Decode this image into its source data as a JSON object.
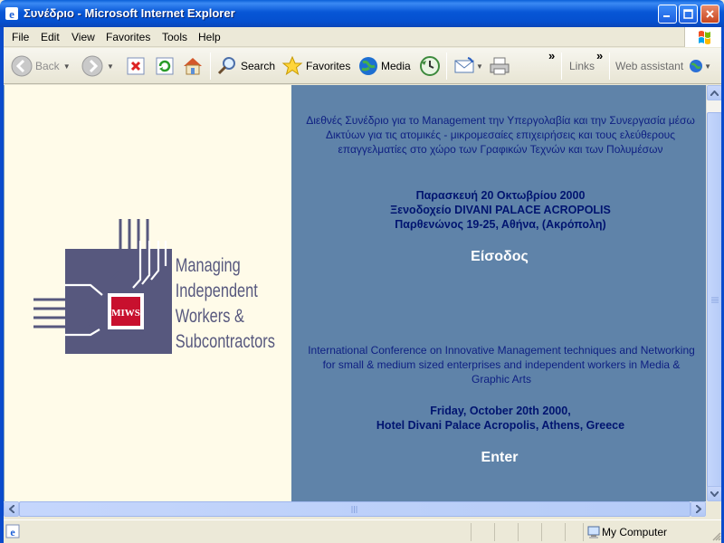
{
  "window": {
    "title": "Συνέδριο - Microsoft Internet Explorer"
  },
  "menu": {
    "items": [
      "File",
      "Edit",
      "View",
      "Favorites",
      "Tools",
      "Help"
    ]
  },
  "toolbar": {
    "back_label": "Back",
    "search_label": "Search",
    "favorites_label": "Favorites",
    "media_label": "Media",
    "links_label": "Links",
    "web_assistant_label": "Web assistant",
    "chevron": "»"
  },
  "logo": {
    "badge": "MIWS",
    "line1": "Managing",
    "line2": "Independent",
    "line3": "Workers &",
    "line4": "Subcontractors"
  },
  "greek": {
    "description": "Διεθνές Συνέδριο για το Management την Υπεργολαβία και την Συνεργασία μέσω Δικτύων για τις ατομικές - μικρομεσαίες επιχειρήσεις και τους ελεύθερους επαγγελματίες στο χώρο των Γραφικών Τεχνών και των Πολυμέσων",
    "date": "Παρασκευή 20 Οκτωβρίου 2000",
    "venue": "Ξενοδοχείο DIVANI PALACE ACROPOLIS",
    "address": "Παρθενώνος 19-25, Αθήνα, (Ακρόπολη)",
    "enter": "Είσοδος"
  },
  "english": {
    "description": "International Conference on Innovative Management techniques and Networking for small & medium sized enterprises and independent workers in Media & Graphic Arts",
    "date": "Friday, October 20th 2000,",
    "venue": "Hotel Divani Palace Acropolis, Athens, Greece",
    "enter": "Enter"
  },
  "status": {
    "zone": "My Computer"
  },
  "colors": {
    "right_panel": "#5f83a9",
    "left_panel": "#fffbe9",
    "text_blue": "#0e1f82",
    "logo_blue": "#57587e",
    "badge_red": "#c8102e"
  }
}
